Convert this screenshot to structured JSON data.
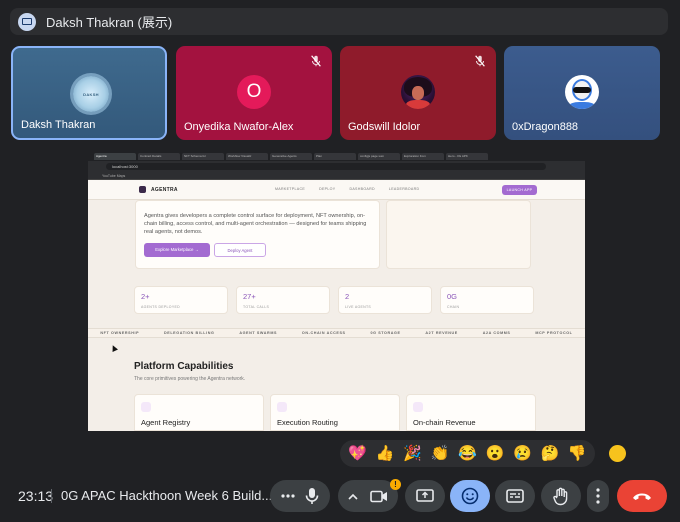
{
  "presenter": {
    "label": "Daksh Thakran (展示)"
  },
  "participants": [
    {
      "name": "Daksh Thakran",
      "avatar_text": "DAKSH",
      "muted": false,
      "speaking": true
    },
    {
      "name": "Onyedika Nwafor-Alex",
      "avatar_text": "O",
      "muted": true
    },
    {
      "name": "Godswill Idolor",
      "muted": true
    },
    {
      "name": "0xDragon888",
      "muted": false
    }
  ],
  "screen": {
    "tabs": [
      "Agentra",
      "Contract Details",
      "NFT Schema for",
      "Workflow Visualiz",
      "Generative Agents",
      "Plan",
      "configjs page sum",
      "Exploration from",
      "Hero - 0G APK"
    ],
    "url": "localhost:3000",
    "bookmark": "YouTube  Maps",
    "nav": {
      "brand": "AGENTRA",
      "links": [
        "MARKETPLACE",
        "DEPLOY",
        "DASHBOARD",
        "LEADERBOARD"
      ],
      "launch": "LAUNCH APP"
    },
    "hero": {
      "description": "Agentra gives developers a complete control surface for deployment, NFT ownership, on-chain billing, access control, and multi-agent orchestration — designed for teams shipping real agents, not demos.",
      "explore_button": "Explore Marketplace  →",
      "deploy_button": "Deploy Agent"
    },
    "stats": [
      {
        "value": "2+",
        "label": "AGENTS DEPLOYED"
      },
      {
        "value": "27+",
        "label": "TOTAL CALLS"
      },
      {
        "value": "2",
        "label": "LIVE AGENTS"
      },
      {
        "value": "0G",
        "label": "CHAIN"
      }
    ],
    "ticker": [
      "NFT OWNERSHIP",
      "DELEGATION BILLING",
      "AGENT SWARMS",
      "ON-CHAIN ACCESS",
      "0G STORAGE",
      "A2T REVENUE",
      "A2A COMMS",
      "MCP PROTOCOL"
    ],
    "capabilities": {
      "title": "Platform Capabilities",
      "subtitle": "The core primitives powering the Agentra network.",
      "features": [
        "Agent Registry",
        "Execution Routing",
        "On-chain Revenue"
      ]
    }
  },
  "reactions": [
    "💖",
    "👍",
    "🎉",
    "👏",
    "😂",
    "😮",
    "😢",
    "🤔",
    "👎"
  ],
  "bottom_bar": {
    "time": "23:13",
    "meeting_title": "0G APAC Hackthoon Week 6 Build...",
    "camera_badge": "!"
  },
  "colors": {
    "accent": "#8ab4f8",
    "end_call": "#ea4335",
    "site_accent": "#a36bd1"
  }
}
